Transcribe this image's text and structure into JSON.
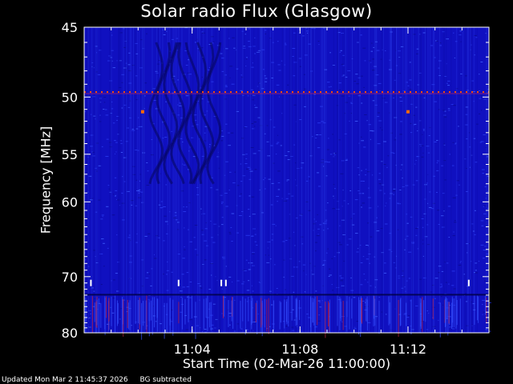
{
  "chart_data": {
    "type": "heatmap",
    "title": "Solar radio Flux (Glasgow)",
    "xlabel": "Start Time (02-Mar-26 11:00:00)",
    "ylabel": "Frequency [MHz]",
    "x_unit": "time",
    "xlim": [
      "11:00:00",
      "11:15:00"
    ],
    "ylim": [
      45,
      80
    ],
    "y_scale": "reciprocal",
    "x_ticks": [
      "11:04",
      "11:08",
      "11:12"
    ],
    "y_ticks": [
      45,
      50,
      55,
      60,
      70,
      80
    ],
    "colormap": {
      "low": "#1010c0",
      "mid": "#3050ff",
      "high": "#ff6000"
    },
    "features": {
      "interference_line_mhz": 49.6,
      "spike_times_near_51mhz": [
        "11:02:10",
        "11:12:00"
      ],
      "white_markers_at_71mhz": [
        "11:00:15",
        "11:03:30",
        "11:05:05",
        "11:05:15",
        "11:14:15"
      ],
      "interference_band_mhz": [
        73,
        80
      ]
    }
  },
  "footer": {
    "updated": "Updated Mon Mar  2 11:45:37 2026",
    "note": "BG subtracted"
  }
}
